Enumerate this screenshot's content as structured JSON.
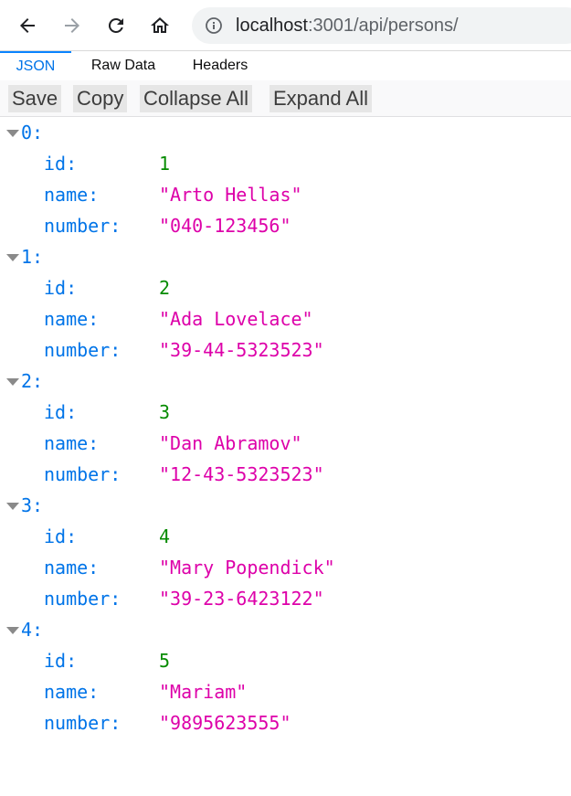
{
  "browser": {
    "url_host": "localhost",
    "url_rest": ":3001/api/persons/"
  },
  "tabs": [
    {
      "label": "JSON",
      "active": true
    },
    {
      "label": "Raw Data",
      "active": false
    },
    {
      "label": "Headers",
      "active": false
    }
  ],
  "toolbar": {
    "save_label": "Save",
    "copy_label": "Copy",
    "collapse_label": "Collapse All",
    "expand_label": "Expand All"
  },
  "tree": {
    "fields": {
      "id": "id:",
      "name": "name:",
      "number": "number:"
    },
    "items": [
      {
        "index": "0:",
        "id": "1",
        "name": "\"Arto Hellas\"",
        "number": "\"040-123456\""
      },
      {
        "index": "1:",
        "id": "2",
        "name": "\"Ada Lovelace\"",
        "number": "\"39-44-5323523\""
      },
      {
        "index": "2:",
        "id": "3",
        "name": "\"Dan Abramov\"",
        "number": "\"12-43-5323523\""
      },
      {
        "index": "3:",
        "id": "4",
        "name": "\"Mary Popendick\"",
        "number": "\"39-23-6423122\""
      },
      {
        "index": "4:",
        "id": "5",
        "name": "\"Mariam\"",
        "number": "\"9895623555\""
      }
    ]
  },
  "colors": {
    "key": "#0074e8",
    "number_value": "#058b00",
    "string_value": "#dd00a9",
    "active_tab": "#0a84ff"
  }
}
